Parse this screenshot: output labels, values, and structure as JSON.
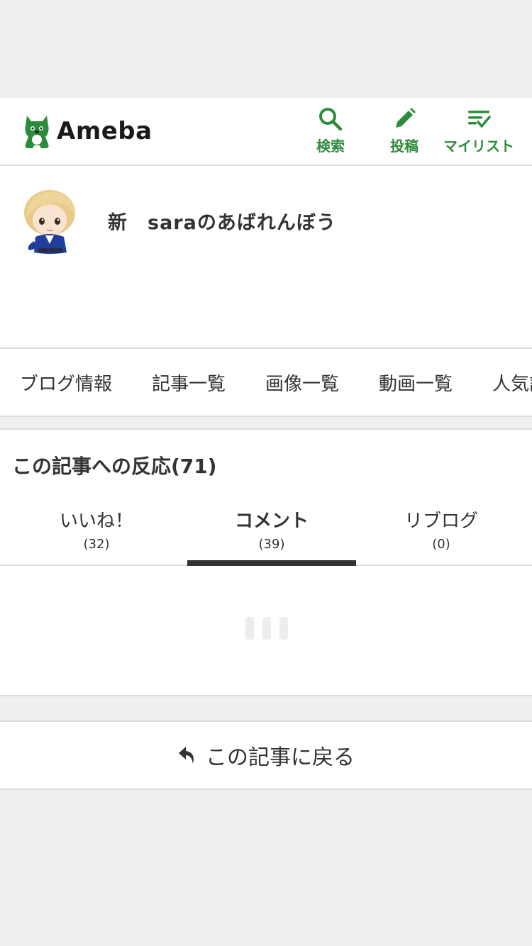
{
  "header": {
    "logo_text": "Ameba",
    "search_label": "検索",
    "post_label": "投稿",
    "mylist_label": "マイリスト",
    "accent_color": "#2d8c3c"
  },
  "profile": {
    "blog_title": "新　saraのあばれんぼう"
  },
  "blog_nav": {
    "items": [
      "ブログ情報",
      "記事一覧",
      "画像一覧",
      "動画一覧",
      "人気記"
    ]
  },
  "reactions": {
    "title": "この記事への反応(71)",
    "tabs": [
      {
        "label": "いいね！",
        "count": "(32)"
      },
      {
        "label": "コメント",
        "count": "(39)"
      },
      {
        "label": "リブログ",
        "count": "(0)"
      }
    ],
    "active_tab": "コメント"
  },
  "back": {
    "label": "この記事に戻る"
  }
}
